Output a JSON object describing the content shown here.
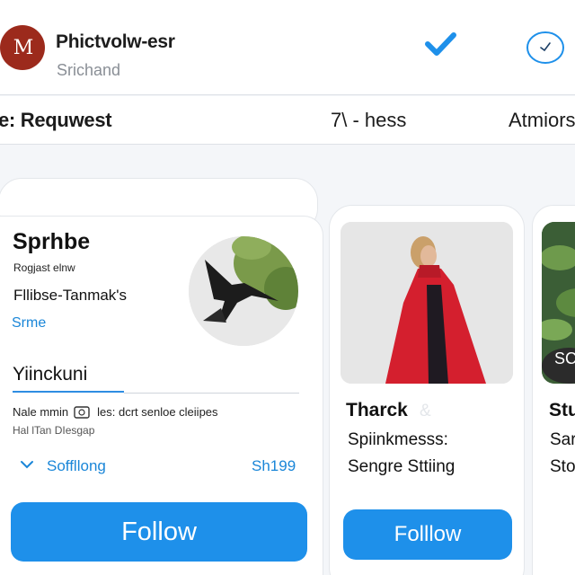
{
  "header": {
    "avatar_initials": "M",
    "title": "Phictvolw-esr",
    "subtitle": "Srichand",
    "icons": [
      "check-icon",
      "circle-check-icon"
    ],
    "accent_color": "#1e90ea"
  },
  "tabs": [
    {
      "label": "e: Requwest"
    },
    {
      "label": "7\\ - hess"
    },
    {
      "label": "Atmiors"
    }
  ],
  "cards": {
    "main": {
      "name": "Sprhbe",
      "subtext": "Rogjast elnw",
      "handle": "Fllibse-Tanmak's",
      "link": "Srme",
      "section_title": "Yiinckuni",
      "meta_left": "Nale mmin",
      "meta_right": "les: dcrt senloe cleiipes",
      "meta_line2": "Hal lTan DIesgap",
      "expand_label": "Soffllong",
      "price": "Sh199",
      "button": "Follow"
    },
    "second": {
      "title": "Tharck",
      "ghost_text": "&",
      "line1": "Spiinkmesss:",
      "line2": "Sengre Sttiing",
      "button": "Folllow"
    },
    "third": {
      "overlay": "SC",
      "title": "Stu",
      "line1": "Sar",
      "line2": "Sto"
    }
  }
}
